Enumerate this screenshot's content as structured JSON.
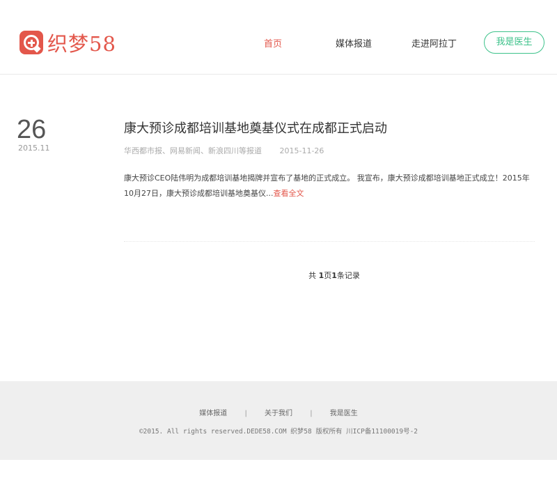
{
  "header": {
    "logo_text": "织梦58",
    "nav": {
      "home": "首页",
      "media": "媒体报道",
      "about": "走进阿拉丁",
      "doctor_button": "我是医生"
    }
  },
  "article": {
    "day": "26",
    "year_month": "2015.11",
    "title": "康大预诊成都培训基地奠基仪式在成都正式启动",
    "sources": "华西都市报、网易新闻、新浪四川等报道",
    "date": "2015-11-26",
    "summary": "康大预诊CEO陆伟明为成都培训基地揭牌并宣布了基地的正式成立。 我宣布，康大预诊成都培训基地正式成立！2015年10月27日，康大预诊成都培训基地奠基仪...",
    "read_more": "查看全文"
  },
  "pager": {
    "prefix": "共 ",
    "pages": "1",
    "mid": "页",
    "records": "1",
    "suffix": "条记录"
  },
  "footer": {
    "links": [
      "媒体报道",
      "关于我们",
      "我是医生"
    ],
    "separator": "|",
    "copyright": "©2015. All rights reserved.DEDE58.COM 织梦58 版权所有 川ICP备11100019号-2"
  },
  "colors": {
    "accent": "#e3574b",
    "doctor_button": "#3cc28a",
    "footer_bg": "#efefef"
  }
}
